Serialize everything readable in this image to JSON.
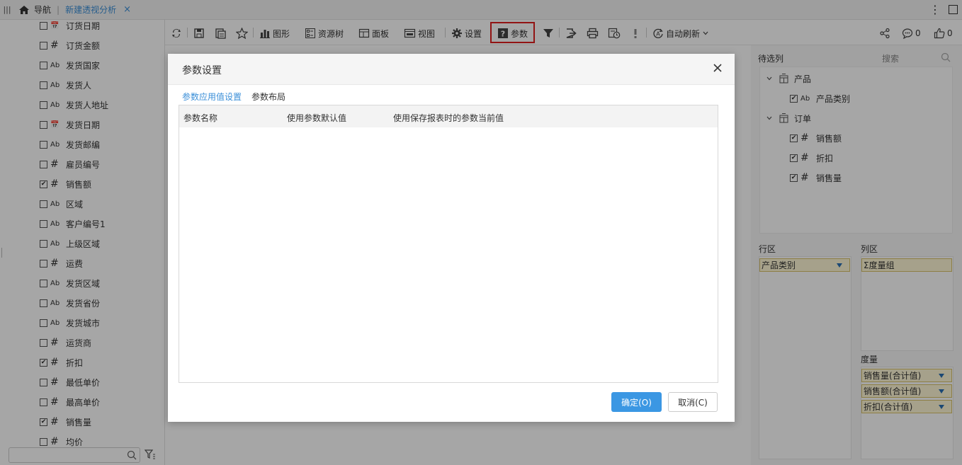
{
  "topbar": {
    "nav_label": "导航",
    "active_tab": "新建透视分析",
    "close_glyph": "×"
  },
  "left_fields": [
    {
      "name": "订货日期",
      "type": "date",
      "checked": false
    },
    {
      "name": "订货金额",
      "type": "number",
      "checked": false
    },
    {
      "name": "发货国家",
      "type": "text",
      "checked": false
    },
    {
      "name": "发货人",
      "type": "text",
      "checked": false
    },
    {
      "name": "发货人地址",
      "type": "text",
      "checked": false
    },
    {
      "name": "发货日期",
      "type": "date",
      "checked": false
    },
    {
      "name": "发货邮编",
      "type": "text",
      "checked": false
    },
    {
      "name": "雇员编号",
      "type": "number",
      "checked": false
    },
    {
      "name": "销售额",
      "type": "number",
      "checked": true
    },
    {
      "name": "区域",
      "type": "text",
      "checked": false
    },
    {
      "name": "客户编号1",
      "type": "text",
      "checked": false
    },
    {
      "name": "上级区域",
      "type": "text",
      "checked": false
    },
    {
      "name": "运费",
      "type": "number",
      "checked": false
    },
    {
      "name": "发货区域",
      "type": "text",
      "checked": false
    },
    {
      "name": "发货省份",
      "type": "text",
      "checked": false
    },
    {
      "name": "发货城市",
      "type": "text",
      "checked": false
    },
    {
      "name": "运货商",
      "type": "number",
      "checked": false
    },
    {
      "name": "折扣",
      "type": "number",
      "checked": true
    },
    {
      "name": "最低单价",
      "type": "number",
      "checked": false
    },
    {
      "name": "最高单价",
      "type": "number",
      "checked": false
    },
    {
      "name": "销售量",
      "type": "number",
      "checked": true
    },
    {
      "name": "均价",
      "type": "number",
      "checked": false
    }
  ],
  "toolbar": {
    "chart": "图形",
    "resource_tree": "资源树",
    "panel": "面板",
    "view": "视图",
    "settings": "设置",
    "params": "参数",
    "auto_refresh": "自动刷新",
    "comment_count": "0",
    "like_count": "0"
  },
  "right_panel": {
    "pending_title": "待选列",
    "search_placeholder": "搜索",
    "tree": [
      {
        "label": "产品",
        "children": [
          {
            "label": "产品类别",
            "type": "text",
            "checked": true
          }
        ]
      },
      {
        "label": "订单",
        "children": [
          {
            "label": "销售额",
            "type": "number",
            "checked": true
          },
          {
            "label": "折扣",
            "type": "number",
            "checked": true
          },
          {
            "label": "销售量",
            "type": "number",
            "checked": true
          }
        ]
      }
    ],
    "row_zone_title": "行区",
    "col_zone_title": "列区",
    "measure_title": "度量",
    "row_chips": [
      "产品类别"
    ],
    "col_chips": [
      "度量组"
    ],
    "measure_chips": [
      "销售量(合计值)",
      "销售额(合计值)",
      "折扣(合计值)"
    ]
  },
  "dialog": {
    "title": "参数设置",
    "tabs": [
      "参数应用值设置",
      "参数布局"
    ],
    "columns": [
      "参数名称",
      "使用参数默认值",
      "使用保存报表时的参数当前值"
    ],
    "ok": "确定(O)",
    "cancel": "取消(C)"
  }
}
